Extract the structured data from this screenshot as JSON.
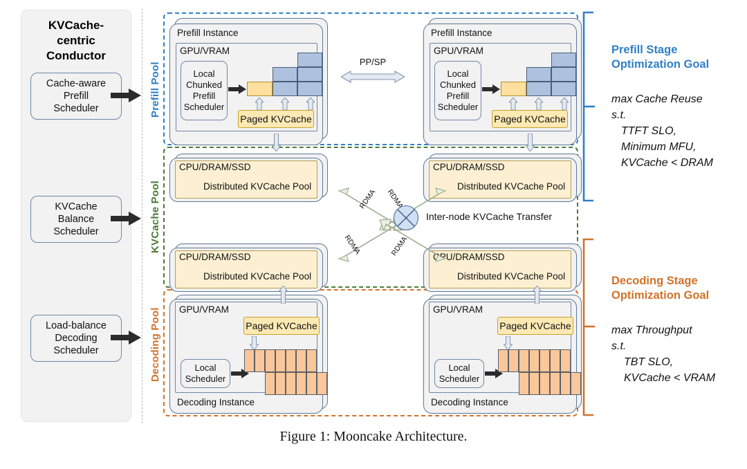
{
  "figure": {
    "caption": "Figure 1: Mooncake Architecture."
  },
  "conductor": {
    "title": "KVCache-\ncentric\nConductor",
    "schedulers": [
      {
        "label": "Cache-aware\nPrefill\nScheduler"
      },
      {
        "label": "KVCache\nBalance\nScheduler"
      },
      {
        "label": "Load-balance\nDecoding\nScheduler"
      }
    ]
  },
  "pools": [
    {
      "name": "prefill",
      "label": "Prefill Pool",
      "color": "#2f7fc7"
    },
    {
      "name": "kvcache",
      "label": "KVCache Pool",
      "color": "#4a7b37"
    },
    {
      "name": "decoding",
      "label": "Decoding Pool",
      "color": "#d2722a"
    }
  ],
  "prefill_instances": [
    {
      "title": "Prefill Instance",
      "gpu_label": "GPU/VRAM",
      "scheduler_label": "Local\nChunked\nPrefill\nScheduler",
      "paged_cache_label": "Paged KVCache"
    },
    {
      "title": "Prefill Instance",
      "gpu_label": "GPU/VRAM",
      "scheduler_label": "Local\nChunked\nPrefill\nScheduler",
      "paged_cache_label": "Paged KVCache"
    }
  ],
  "prefill_link": {
    "label": "PP/SP"
  },
  "kvcache_nodes": [
    {
      "top_label": "CPU/DRAM/SSD",
      "bottom_label": "Distributed KVCache Pool"
    },
    {
      "top_label": "CPU/DRAM/SSD",
      "bottom_label": "Distributed KVCache Pool"
    },
    {
      "top_label": "CPU/DRAM/SSD",
      "bottom_label": "Distributed KVCache Pool"
    },
    {
      "top_label": "CPU/DRAM/SSD",
      "bottom_label": "Distributed KVCache Pool"
    }
  ],
  "decoding_instances": [
    {
      "title": "Decoding Instance",
      "gpu_label": "GPU/VRAM",
      "paged_cache_label": "Paged KVCache",
      "scheduler_label": "Local\nScheduler"
    },
    {
      "title": "Decoding Instance",
      "gpu_label": "GPU/VRAM",
      "paged_cache_label": "Paged KVCache",
      "scheduler_label": "Local\nScheduler"
    }
  ],
  "transfer": {
    "switch_label": "Inter-node KVCache Transfer",
    "rdma_labels": [
      "RDMA",
      "RDMA",
      "RDMA",
      "RDMA"
    ]
  },
  "goals": [
    {
      "name": "prefill-goal",
      "title": "Prefill Stage\nOptimization Goal",
      "color": "#2f7fc7",
      "objective": "max Cache Reuse",
      "subject_to": "s.t.",
      "constraints": [
        "TTFT SLO,",
        "Minimum MFU,",
        "KVCache < DRAM"
      ]
    },
    {
      "name": "decoding-goal",
      "title": "Decoding Stage\nOptimization Goal",
      "color": "#d2722a",
      "objective": "max Throughput",
      "subject_to": "s.t.",
      "constraints": [
        "TBT SLO,",
        "KVCache < VRAM"
      ]
    }
  ],
  "chart_data": {
    "type": "diagram",
    "title": "Mooncake Architecture",
    "prefill_block_columns": [
      {
        "color": "yellow",
        "count": 1
      },
      {
        "color": "blue",
        "count": 1
      },
      {
        "color": "blue",
        "count": 2
      },
      {
        "color": "blue",
        "count": 3
      }
    ],
    "decoding_block_rows": [
      {
        "cells": 7,
        "offset": 0
      },
      {
        "cells": 6,
        "offset": 3
      }
    ]
  }
}
